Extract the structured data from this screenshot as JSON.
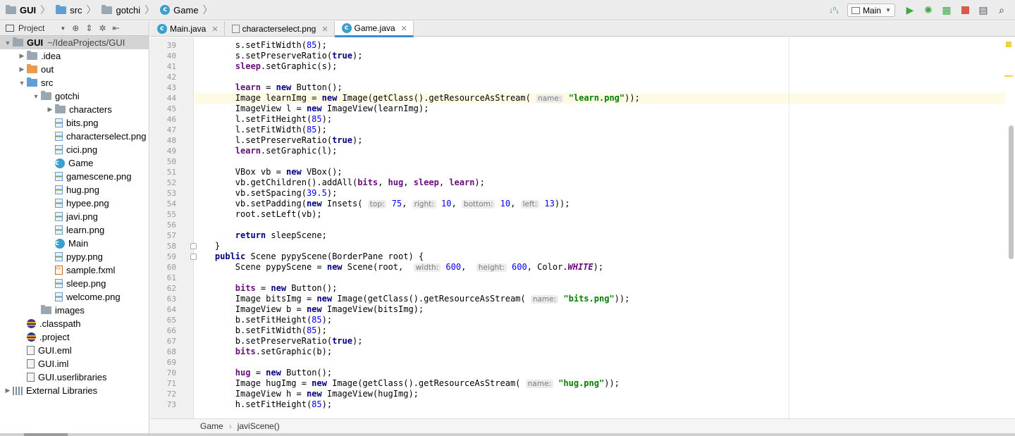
{
  "navbar": {
    "crumbs": [
      {
        "label": "GUI",
        "icon": "module-folder-icon"
      },
      {
        "label": "src",
        "icon": "source-folder-icon"
      },
      {
        "label": "gotchi",
        "icon": "package-folder-icon"
      },
      {
        "label": "Game",
        "icon": "java-class-icon"
      }
    ],
    "run_config": "Main",
    "toolbar": [
      "sort-icon",
      "run-config-icon",
      "run-icon",
      "debug-icon",
      "coverage-icon",
      "stop-icon",
      "project-structure-icon",
      "search-icon"
    ]
  },
  "project_panel": {
    "title": "Project",
    "tree": [
      {
        "label": "GUI",
        "extra": "~/IdeaProjects/GUI",
        "level": 0,
        "arrow": "▼",
        "icon": "module",
        "bold": true,
        "selected": true
      },
      {
        "label": ".idea",
        "level": 1,
        "arrow": "▶",
        "icon": "folder"
      },
      {
        "label": "out",
        "level": 1,
        "arrow": "▶",
        "icon": "folder-orange"
      },
      {
        "label": "src",
        "level": 1,
        "arrow": "▼",
        "icon": "folder-blue"
      },
      {
        "label": "gotchi",
        "level": 2,
        "arrow": "▼",
        "icon": "folder"
      },
      {
        "label": "characters",
        "level": 3,
        "arrow": "▶",
        "icon": "folder"
      },
      {
        "label": "bits.png",
        "level": 3,
        "icon": "png"
      },
      {
        "label": "characterselect.png",
        "level": 3,
        "icon": "png"
      },
      {
        "label": "cici.png",
        "level": 3,
        "icon": "png"
      },
      {
        "label": "Game",
        "level": 3,
        "icon": "class"
      },
      {
        "label": "gamescene.png",
        "level": 3,
        "icon": "png"
      },
      {
        "label": "hug.png",
        "level": 3,
        "icon": "png"
      },
      {
        "label": "hypee.png",
        "level": 3,
        "icon": "png"
      },
      {
        "label": "javi.png",
        "level": 3,
        "icon": "png"
      },
      {
        "label": "learn.png",
        "level": 3,
        "icon": "png"
      },
      {
        "label": "Main",
        "level": 3,
        "icon": "class"
      },
      {
        "label": "pypy.png",
        "level": 3,
        "icon": "png"
      },
      {
        "label": "sample.fxml",
        "level": 3,
        "icon": "fxml"
      },
      {
        "label": "sleep.png",
        "level": 3,
        "icon": "png"
      },
      {
        "label": "welcome.png",
        "level": 3,
        "icon": "png"
      },
      {
        "label": "images",
        "level": 2,
        "icon": "folder"
      },
      {
        "label": ".classpath",
        "level": 1,
        "icon": "eclipse"
      },
      {
        "label": ".project",
        "level": 1,
        "icon": "eclipse"
      },
      {
        "label": "GUI.eml",
        "level": 1,
        "icon": "iml"
      },
      {
        "label": "GUI.iml",
        "level": 1,
        "icon": "iml"
      },
      {
        "label": "GUI.userlibraries",
        "level": 1,
        "icon": "iml"
      },
      {
        "label": "External Libraries",
        "level": 0,
        "arrow": "▶",
        "icon": "library"
      }
    ]
  },
  "tabs": [
    {
      "label": "Main.java",
      "icon": "class",
      "active": false
    },
    {
      "label": "characterselect.png",
      "icon": "image",
      "active": false
    },
    {
      "label": "Game.java",
      "icon": "class",
      "active": true
    }
  ],
  "editor": {
    "caret_line": 44,
    "lines": [
      {
        "n": 39,
        "code": [
          [
            "",
            "        s.setFitWidth("
          ],
          [
            "num",
            "85"
          ],
          [
            "",
            ");"
          ]
        ]
      },
      {
        "n": 40,
        "code": [
          [
            "",
            "        s.setPreserveRatio("
          ],
          [
            "kw",
            "true"
          ],
          [
            "",
            ");"
          ]
        ]
      },
      {
        "n": 41,
        "code": [
          [
            "fld",
            "        sleep"
          ],
          [
            "",
            ".setGraphic(s);"
          ]
        ]
      },
      {
        "n": 42,
        "code": []
      },
      {
        "n": 43,
        "code": [
          [
            "fld",
            "        learn"
          ],
          [
            "",
            " = "
          ],
          [
            "kw",
            "new"
          ],
          [
            "",
            " Button();"
          ]
        ]
      },
      {
        "n": 44,
        "code": [
          [
            "",
            "        Image learnImg = "
          ],
          [
            "kw",
            "new"
          ],
          [
            "",
            " Image(getClass().getResourceAsStream( "
          ],
          [
            "hint",
            "name:"
          ],
          [
            "",
            " "
          ],
          [
            "str",
            "\"learn.png\""
          ],
          [
            "",
            "));"
          ]
        ]
      },
      {
        "n": 45,
        "code": [
          [
            "",
            "        ImageView l = "
          ],
          [
            "kw",
            "new"
          ],
          [
            "",
            " ImageView(learnImg);"
          ]
        ]
      },
      {
        "n": 46,
        "code": [
          [
            "",
            "        l.setFitHeight("
          ],
          [
            "num",
            "85"
          ],
          [
            "",
            ");"
          ]
        ]
      },
      {
        "n": 47,
        "code": [
          [
            "",
            "        l.setFitWidth("
          ],
          [
            "num",
            "85"
          ],
          [
            "",
            ");"
          ]
        ]
      },
      {
        "n": 48,
        "code": [
          [
            "",
            "        l.setPreserveRatio("
          ],
          [
            "kw",
            "true"
          ],
          [
            "",
            ");"
          ]
        ]
      },
      {
        "n": 49,
        "code": [
          [
            "fld",
            "        learn"
          ],
          [
            "",
            ".setGraphic(l);"
          ]
        ]
      },
      {
        "n": 50,
        "code": []
      },
      {
        "n": 51,
        "code": [
          [
            "",
            "        VBox vb = "
          ],
          [
            "kw",
            "new"
          ],
          [
            "",
            " VBox();"
          ]
        ]
      },
      {
        "n": 52,
        "code": [
          [
            "",
            "        vb.getChildren().addAll("
          ],
          [
            "fld",
            "bits"
          ],
          [
            "",
            ", "
          ],
          [
            "fld",
            "hug"
          ],
          [
            "",
            ", "
          ],
          [
            "fld",
            "sleep"
          ],
          [
            "",
            ", "
          ],
          [
            "fld",
            "learn"
          ],
          [
            "",
            ");"
          ]
        ]
      },
      {
        "n": 53,
        "code": [
          [
            "",
            "        vb.setSpacing("
          ],
          [
            "num",
            "39.5"
          ],
          [
            "",
            ");"
          ]
        ]
      },
      {
        "n": 54,
        "code": [
          [
            "",
            "        vb.setPadding("
          ],
          [
            "kw",
            "new"
          ],
          [
            "",
            " Insets( "
          ],
          [
            "hint",
            "top:"
          ],
          [
            "",
            " "
          ],
          [
            "num",
            "75"
          ],
          [
            "",
            ", "
          ],
          [
            "hint",
            "right:"
          ],
          [
            "",
            " "
          ],
          [
            "num",
            "10"
          ],
          [
            "",
            ", "
          ],
          [
            "hint",
            "bottom:"
          ],
          [
            "",
            " "
          ],
          [
            "num",
            "10"
          ],
          [
            "",
            ", "
          ],
          [
            "hint",
            "left:"
          ],
          [
            "",
            " "
          ],
          [
            "num",
            "13"
          ],
          [
            "",
            "));"
          ]
        ]
      },
      {
        "n": 55,
        "code": [
          [
            "",
            "        root.setLeft(vb);"
          ]
        ]
      },
      {
        "n": 56,
        "code": []
      },
      {
        "n": 57,
        "code": [
          [
            "kw",
            "        return"
          ],
          [
            "",
            " sleepScene;"
          ]
        ]
      },
      {
        "n": 58,
        "code": [
          [
            "",
            "    }"
          ]
        ]
      },
      {
        "n": 59,
        "code": [
          [
            "kw",
            "    public"
          ],
          [
            "",
            " Scene pypyScene(BorderPane root) {"
          ]
        ]
      },
      {
        "n": 60,
        "code": [
          [
            "",
            "        Scene pypyScene = "
          ],
          [
            "kw",
            "new"
          ],
          [
            "",
            " Scene(root,  "
          ],
          [
            "hint",
            "width:"
          ],
          [
            "",
            " "
          ],
          [
            "num",
            "600"
          ],
          [
            "",
            ",  "
          ],
          [
            "hint",
            "height:"
          ],
          [
            "",
            " "
          ],
          [
            "num",
            "600"
          ],
          [
            "",
            ", Color."
          ],
          [
            "stat",
            "WHITE"
          ],
          [
            "",
            ");"
          ]
        ]
      },
      {
        "n": 61,
        "code": []
      },
      {
        "n": 62,
        "code": [
          [
            "fld",
            "        bits"
          ],
          [
            "",
            " = "
          ],
          [
            "kw",
            "new"
          ],
          [
            "",
            " Button();"
          ]
        ]
      },
      {
        "n": 63,
        "code": [
          [
            "",
            "        Image bitsImg = "
          ],
          [
            "kw",
            "new"
          ],
          [
            "",
            " Image(getClass().getResourceAsStream( "
          ],
          [
            "hint",
            "name:"
          ],
          [
            "",
            " "
          ],
          [
            "str",
            "\"bits.png\""
          ],
          [
            "",
            "));"
          ]
        ]
      },
      {
        "n": 64,
        "code": [
          [
            "",
            "        ImageView b = "
          ],
          [
            "kw",
            "new"
          ],
          [
            "",
            " ImageView(bitsImg);"
          ]
        ]
      },
      {
        "n": 65,
        "code": [
          [
            "",
            "        b.setFitHeight("
          ],
          [
            "num",
            "85"
          ],
          [
            "",
            ");"
          ]
        ]
      },
      {
        "n": 66,
        "code": [
          [
            "",
            "        b.setFitWidth("
          ],
          [
            "num",
            "85"
          ],
          [
            "",
            ");"
          ]
        ]
      },
      {
        "n": 67,
        "code": [
          [
            "",
            "        b.setPreserveRatio("
          ],
          [
            "kw",
            "true"
          ],
          [
            "",
            ");"
          ]
        ]
      },
      {
        "n": 68,
        "code": [
          [
            "fld",
            "        bits"
          ],
          [
            "",
            ".setGraphic(b);"
          ]
        ]
      },
      {
        "n": 69,
        "code": []
      },
      {
        "n": 70,
        "code": [
          [
            "fld",
            "        hug"
          ],
          [
            "",
            " = "
          ],
          [
            "kw",
            "new"
          ],
          [
            "",
            " Button();"
          ]
        ]
      },
      {
        "n": 71,
        "code": [
          [
            "",
            "        Image hugImg = "
          ],
          [
            "kw",
            "new"
          ],
          [
            "",
            " Image(getClass().getResourceAsStream( "
          ],
          [
            "hint",
            "name:"
          ],
          [
            "",
            " "
          ],
          [
            "str",
            "\"hug.png\""
          ],
          [
            "",
            "));"
          ]
        ]
      },
      {
        "n": 72,
        "code": [
          [
            "",
            "        ImageView h = "
          ],
          [
            "kw",
            "new"
          ],
          [
            "",
            " ImageView(hugImg);"
          ]
        ]
      },
      {
        "n": 73,
        "code": [
          [
            "",
            "        h.setFitHeight("
          ],
          [
            "num",
            "85"
          ],
          [
            "",
            ");"
          ]
        ]
      }
    ]
  },
  "breadcrumb": {
    "items": [
      "Game",
      "javiScene()"
    ]
  }
}
